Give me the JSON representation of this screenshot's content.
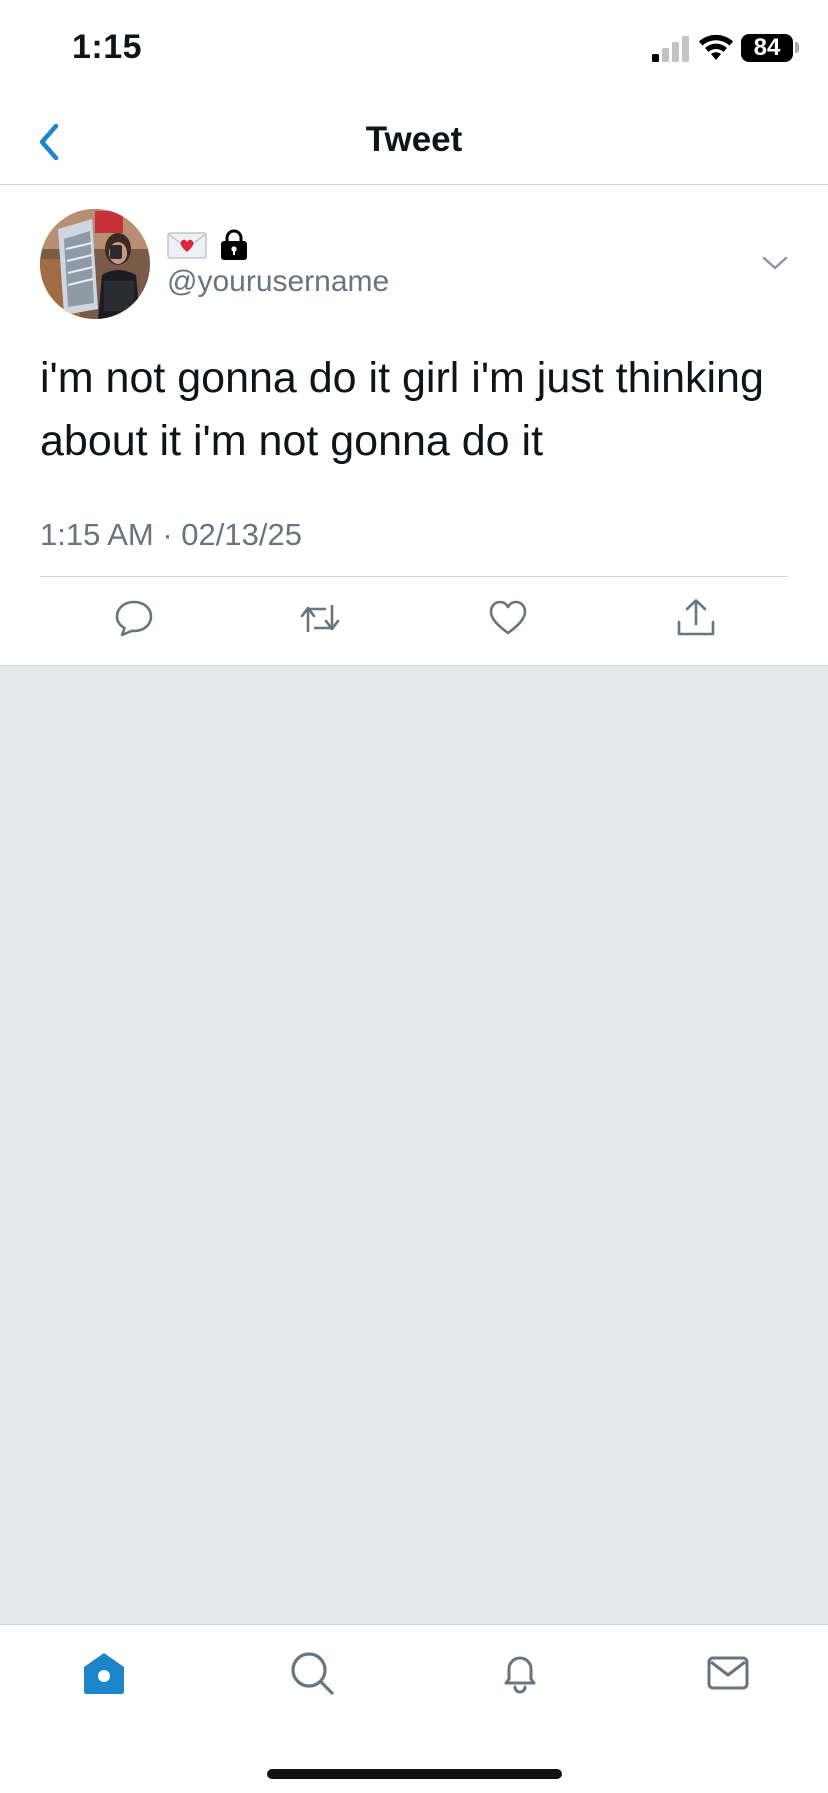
{
  "status_bar": {
    "time": "1:15",
    "battery": "84"
  },
  "header": {
    "title": "Tweet"
  },
  "tweet": {
    "name_emojis": [
      "love-letter-icon",
      "lock-icon"
    ],
    "handle": "@yourusername",
    "text": "i'm not gonna do it girl i'm just thinking about it i'm not gonna do it",
    "timestamp": "1:15 AM · 02/13/25"
  },
  "actions": [
    "reply-icon",
    "retweet-icon",
    "like-icon",
    "share-icon"
  ],
  "tabs": [
    "home-icon",
    "search-icon",
    "notifications-icon",
    "messages-icon"
  ],
  "colors": {
    "accent": "#1b86c9",
    "secondary_text": "#66757f",
    "background_gray": "#e6e9ee",
    "divider": "#cfd6dc"
  }
}
